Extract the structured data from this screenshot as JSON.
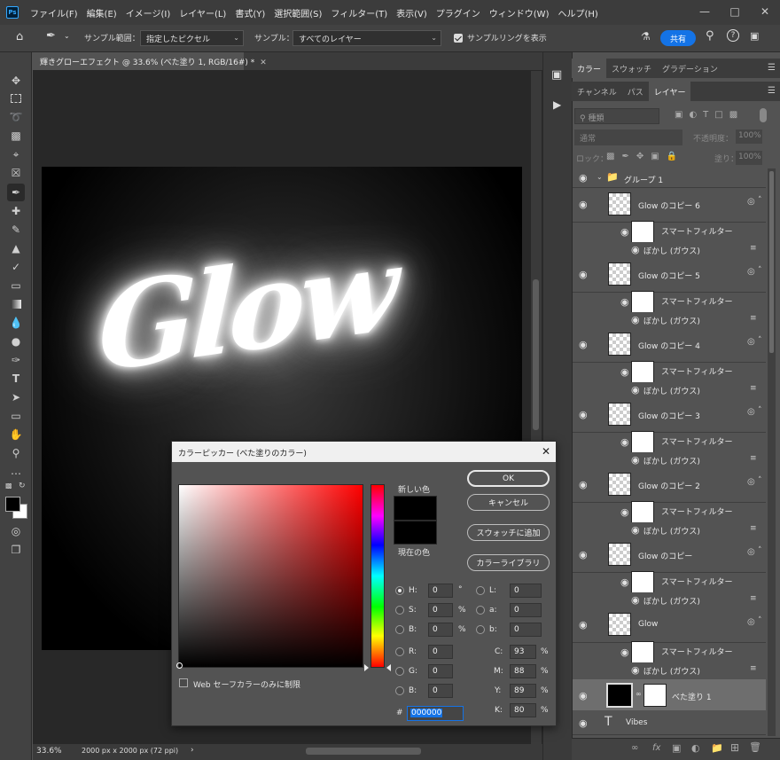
{
  "app": {
    "logo": "Ps"
  },
  "menubar": [
    "ファイル(F)",
    "編集(E)",
    "イメージ(I)",
    "レイヤー(L)",
    "書式(Y)",
    "選択範囲(S)",
    "フィルター(T)",
    "表示(V)",
    "プラグイン",
    "ウィンドウ(W)",
    "ヘルプ(H)"
  ],
  "options": {
    "sample_size_label": "サンプル範囲：",
    "sample_size_value": "指定したピクセル",
    "sample_label": "サンプル：",
    "sample_value": "すべてのレイヤー",
    "show_ring_label": "サンプルリングを表示",
    "share_label": "共有"
  },
  "document": {
    "tab_title": "輝きグローエフェクト @ 33.6% (べた塗り 1, RGB/16#) *",
    "canvas_text": "Glow",
    "zoom": "33.6%",
    "doc_size": "2000 px x 2000 px (72 ppi)"
  },
  "panels": {
    "top_tabs": [
      "カラー",
      "スウォッチ",
      "グラデーション"
    ],
    "layer_tabs": [
      "チャンネル",
      "パス",
      "レイヤー"
    ],
    "filter_kind": "種類",
    "blend_mode": "通常",
    "opacity_label": "不透明度：",
    "opacity_value": "100%",
    "lock_label": "ロック：",
    "fill_label": "塗り：",
    "fill_value": "100%",
    "group_name": "グループ 1",
    "smart_filter_label": "スマートフィルター",
    "blur_label": "ぼかし (ガウス)",
    "layers": [
      "Glow のコピー 6",
      "Glow のコピー 5",
      "Glow のコピー 4",
      "Glow のコピー 3",
      "Glow のコピー 2",
      "Glow のコピー",
      "Glow"
    ],
    "fill_layer": "べた塗り 1",
    "text_layer": "Vibes"
  },
  "dialog": {
    "title": "カラーピッカー (べた塗りのカラー)",
    "new_label": "新しい色",
    "current_label": "現在の色",
    "ok": "OK",
    "cancel": "キャンセル",
    "add_swatch": "スウォッチに追加",
    "color_library": "カラーライブラリ",
    "web_safe": "Web セーフカラーのみに制限",
    "H": "0",
    "S": "0",
    "B": "0",
    "R": "0",
    "G": "0",
    "Bv": "0",
    "L": "0",
    "a": "0",
    "b": "0",
    "C": "93",
    "M": "88",
    "Y": "89",
    "K": "80",
    "hex": "000000",
    "deg": "°",
    "pct": "%",
    "hex_label": "#",
    "new_color": "#000000",
    "current_color": "#000000"
  }
}
